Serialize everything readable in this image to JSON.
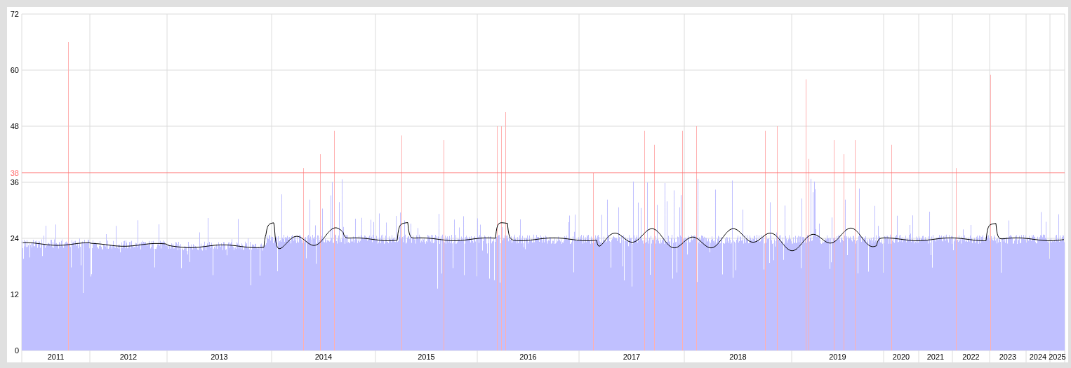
{
  "chart": {
    "y_ticks": [
      "72",
      "60",
      "48",
      "36",
      "24",
      "12",
      "0"
    ],
    "threshold_label": "38",
    "years": [
      "2011",
      "2012",
      "2013",
      "2014",
      "2015",
      "2016",
      "2017",
      "2018",
      "2019",
      "2020",
      "2021",
      "2022",
      "2023",
      "2024",
      "2025"
    ]
  }
}
